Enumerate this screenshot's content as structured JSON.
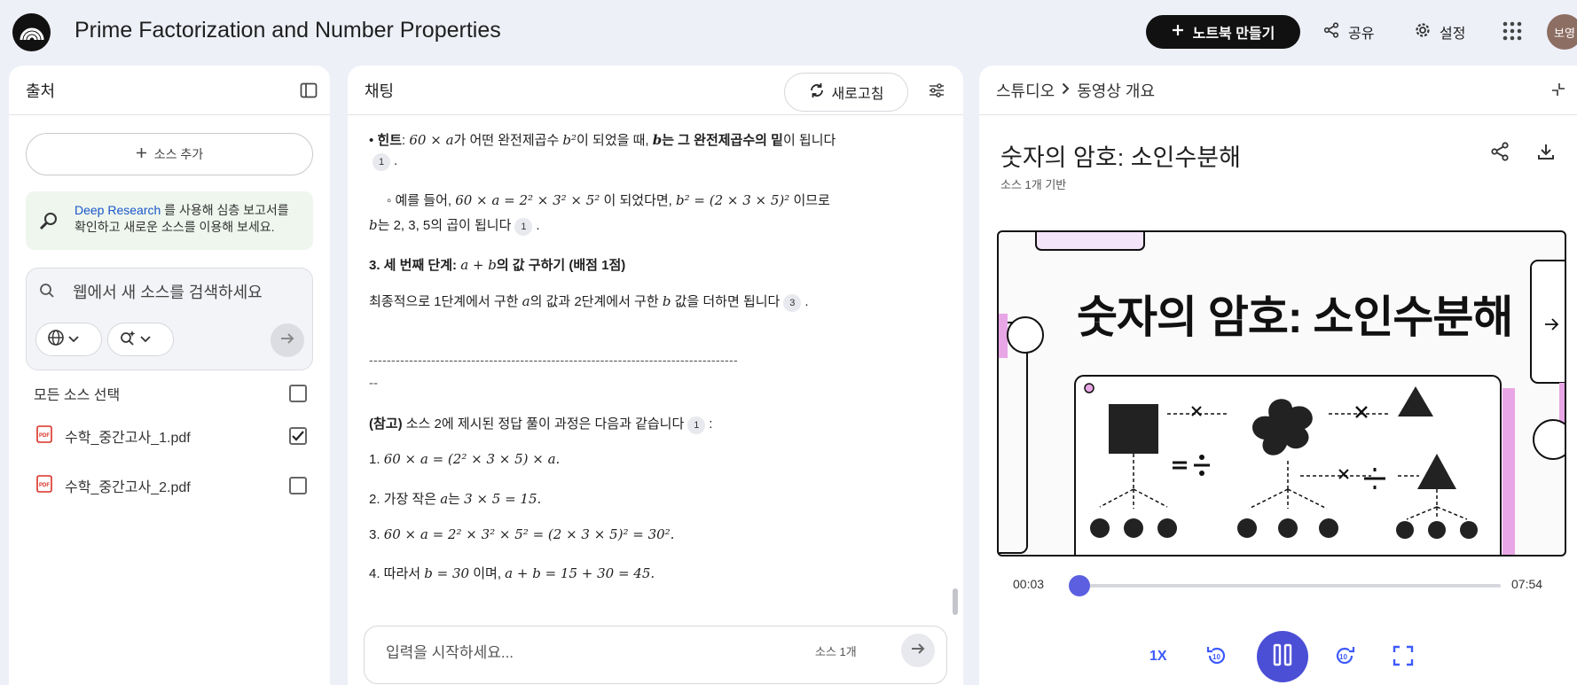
{
  "header": {
    "title": "Prime Factorization and Number Properties",
    "new_notebook_label": "노트북 만들기",
    "share_label": "공유",
    "settings_label": "설정",
    "avatar_label": "보영"
  },
  "sources_panel": {
    "title": "출처",
    "add_source_label": "소스 추가",
    "deep_research": {
      "link": "Deep Research",
      "text_1": "를 사용해 심층 보고서를",
      "text_2": "확인하고 새로운 소스를 이용해 보세요."
    },
    "search_placeholder": "웹에서 새 소스를 검색하세요",
    "select_all_label": "모든 소스 선택",
    "files": [
      {
        "name": "수학_중간고사_1.pdf",
        "checked": true
      },
      {
        "name": "수학_중간고사_2.pdf",
        "checked": false
      }
    ]
  },
  "chat_panel": {
    "title": "채팅",
    "refresh_label": "새로고침",
    "lines": {
      "hint_label": "힌트",
      "hint_math_1": "60 × a",
      "hint_text_1": "가 어떤 완전제곱수 ",
      "hint_math_2": "b²",
      "hint_text_2": "이 되었을 때, ",
      "hint_math_3": "b",
      "hint_bold": "는 그 완전제곱수의 밑",
      "hint_text_3": "이 됩니다",
      "cite_1": "1",
      "ex_text_1": "예를 들어, ",
      "ex_math_1": "60 × a = 2² × 3² × 5²",
      "ex_text_2": " 이 되었다면, ",
      "ex_math_2": "b² = (2 × 3 × 5)²",
      "ex_text_3": " 이므로",
      "ex_math_3": "b",
      "ex_text_4": "는 2, 3, 5의 곱이 됩니다",
      "step3_title_1": "3. 세 번째 단계: ",
      "step3_math": "a + b",
      "step3_title_2": "의 값 구하기 (배점 1점)",
      "final_text_1": "최종적으로 1단계에서 구한 ",
      "final_math_1": "a",
      "final_text_2": "의 값과 2단계에서 구한 ",
      "final_math_2": "b",
      "final_text_3": " 값을 더하면 됩니다",
      "cite_3": "3",
      "dashes": "-----------------------------------------------------------------------------------",
      "dashes_2": "--",
      "ref_label": "(참고)",
      "ref_text": " 소스 2에 제시된 정답 풀이 과정은 다음과 같습니다",
      "sol_1_num": "1. ",
      "sol_1_math": "60 × a = (2² × 3 × 5) × a.",
      "sol_2_text": "2. 가장 작은 ",
      "sol_2_math_a": "a",
      "sol_2_text_b": "는 ",
      "sol_2_math_b": "3 × 5 = 15.",
      "sol_3_num": "3. ",
      "sol_3_math": "60 × a = 2² × 3² × 5² = (2 × 3 × 5)² = 30².",
      "sol_4_text": "4. 따라서 ",
      "sol_4_math_a": "b = 30",
      "sol_4_text_b": " 이며, ",
      "sol_4_math_b": "a + b = 15 + 30 = 45."
    },
    "input_placeholder": "입력을 시작하세요...",
    "source_count": "소스 1개"
  },
  "studio_panel": {
    "breadcrumb_root": "스튜디오",
    "breadcrumb_current": "동영상 개요",
    "video_title": "숫자의 암호: 소인수분해",
    "video_subtitle": "소스 1개 기반",
    "frame_title": "숫자의 암호: 소인수분해",
    "current_time": "00:03",
    "duration": "07:54",
    "progress": 0.006,
    "speed_label": "1X"
  },
  "colors": {
    "accent": "#4b4fd6",
    "background": "#eef0f8"
  }
}
